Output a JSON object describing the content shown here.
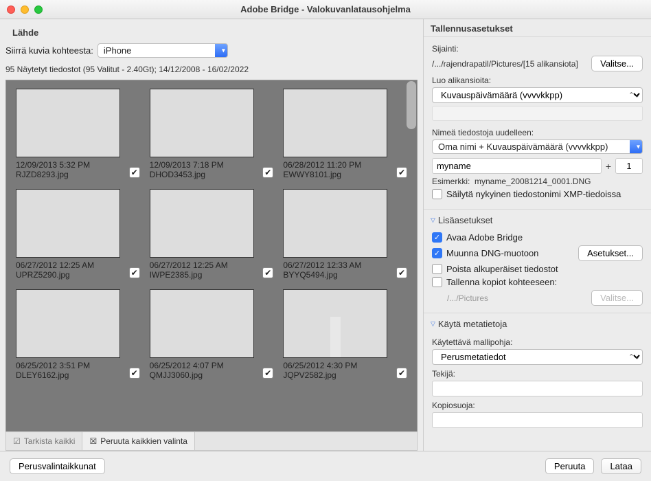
{
  "window": {
    "title": "Adobe Bridge - Valokuvanlatausohjelma"
  },
  "source": {
    "heading": "Lähde",
    "transfer_label": "Siirrä kuvia kohteesta:",
    "device": "iPhone",
    "summary": "95 Näytetyt tiedostot (95 Valitut - 2.40Gt); 14/12/2008 - 16/02/2022"
  },
  "thumbs": [
    {
      "date": "12/09/2013 5:32 PM",
      "file": "RJZD8293.jpg",
      "style": "people"
    },
    {
      "date": "12/09/2013 7:18 PM",
      "file": "DHOD3453.jpg",
      "style": "orange"
    },
    {
      "date": "06/28/2012 11:20 PM",
      "file": "EWWY8101.jpg",
      "style": "dark"
    },
    {
      "date": "06/27/2012 12:25 AM",
      "file": "UPRZ5290.jpg",
      "style": "ice"
    },
    {
      "date": "06/27/2012 12:25 AM",
      "file": "IWPE2385.jpg",
      "style": "ice"
    },
    {
      "date": "06/27/2012 12:33 AM",
      "file": "BYYQ5494.jpg",
      "style": "ice"
    },
    {
      "date": "06/25/2012 3:51 PM",
      "file": "DLEY6162.jpg",
      "style": "mono"
    },
    {
      "date": "06/25/2012 4:07 PM",
      "file": "QMJJ3060.jpg",
      "style": "mono"
    },
    {
      "date": "06/25/2012 4:30 PM",
      "file": "JQPV2582.jpg",
      "style": "falls"
    }
  ],
  "toolbar": {
    "check_all": "Tarkista kaikki",
    "uncheck_all": "Peruuta kaikkien valinta"
  },
  "save": {
    "heading": "Tallennusasetukset",
    "location_label": "Sijainti:",
    "location_path": "/.../rajendrapatil/Pictures/[15 alikansiota]",
    "choose": "Valitse...",
    "subfolders_label": "Luo alikansioita:",
    "subfolders_value": "Kuvauspäivämäärä (vvvvkkpp)",
    "rename_label": "Nimeä tiedostoja uudelleen:",
    "rename_scheme": "Oma nimi + Kuvauspäivämäärä (vvvvkkpp)",
    "custom_name": "myname",
    "seq_start": "1",
    "example_label": "Esimerkki:",
    "example_value": "myname_20081214_0001.DNG",
    "preserve_xmp": "Säilytä nykyinen tiedostonimi XMP-tiedoissa"
  },
  "advanced": {
    "heading": "Lisäasetukset",
    "open_bridge": "Avaa Adobe Bridge",
    "convert_dng": "Muunna DNG-muotoon",
    "settings": "Asetukset...",
    "delete_originals": "Poista alkuperäiset tiedostot",
    "save_copies": "Tallenna kopiot kohteeseen:",
    "copies_path": "/.../Pictures",
    "choose": "Valitse..."
  },
  "metadata": {
    "heading": "Käytä metatietoja",
    "template_label": "Käytettävä mallipohja:",
    "template_value": "Perusmetatiedot",
    "creator_label": "Tekijä:",
    "copyright_label": "Kopiosuoja:"
  },
  "footer": {
    "basic_dialogs": "Perusvalintaikkunat",
    "cancel": "Peruuta",
    "download": "Lataa"
  }
}
